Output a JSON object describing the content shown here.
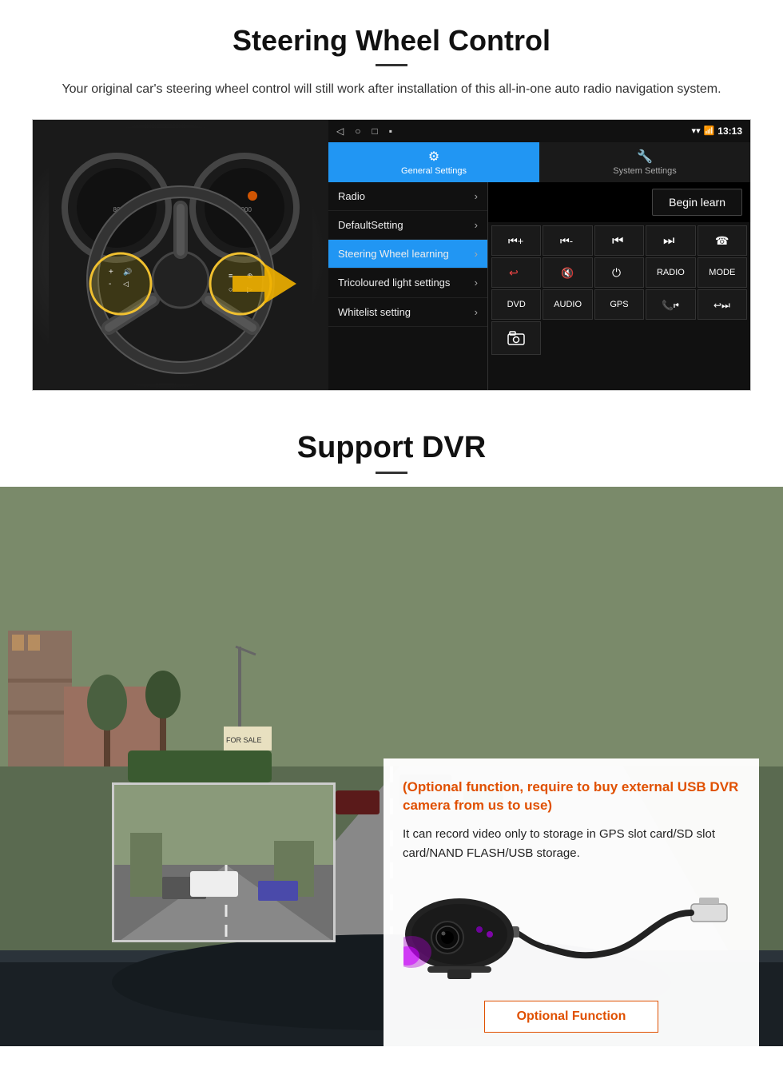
{
  "swc": {
    "title": "Steering Wheel Control",
    "description": "Your original car's steering wheel control will still work after installation of this all-in-one auto radio navigation system.",
    "statusbar": {
      "time": "13:13",
      "signal_icon": "▼",
      "wifi_icon": "▾",
      "battery_icon": "▪"
    },
    "navbar": {
      "back": "◁",
      "home": "○",
      "square": "□",
      "menu": "▪"
    },
    "tabs": [
      {
        "icon": "⚙",
        "label": "General Settings",
        "active": true
      },
      {
        "icon": "🔧",
        "label": "System Settings",
        "active": false
      }
    ],
    "menu_items": [
      {
        "label": "Radio",
        "active": false
      },
      {
        "label": "DefaultSetting",
        "active": false
      },
      {
        "label": "Steering Wheel learning",
        "active": true
      },
      {
        "label": "Tricoloured light settings",
        "active": false
      },
      {
        "label": "Whitelist setting",
        "active": false
      }
    ],
    "begin_learn": "Begin learn",
    "control_buttons": [
      "⏮+",
      "⏮-",
      "⏮",
      "⏭",
      "☎",
      "↩",
      "🔇",
      "⏻",
      "RADIO",
      "MODE",
      "DVD",
      "AUDIO",
      "GPS",
      "📞⏮",
      "↩⏭",
      "📷"
    ]
  },
  "dvr": {
    "title": "Support DVR",
    "optional_text": "(Optional function, require to buy external USB DVR camera from us to use)",
    "description": "It can record video only to storage in GPS slot card/SD slot card/NAND FLASH/USB storage.",
    "optional_button": "Optional Function"
  }
}
